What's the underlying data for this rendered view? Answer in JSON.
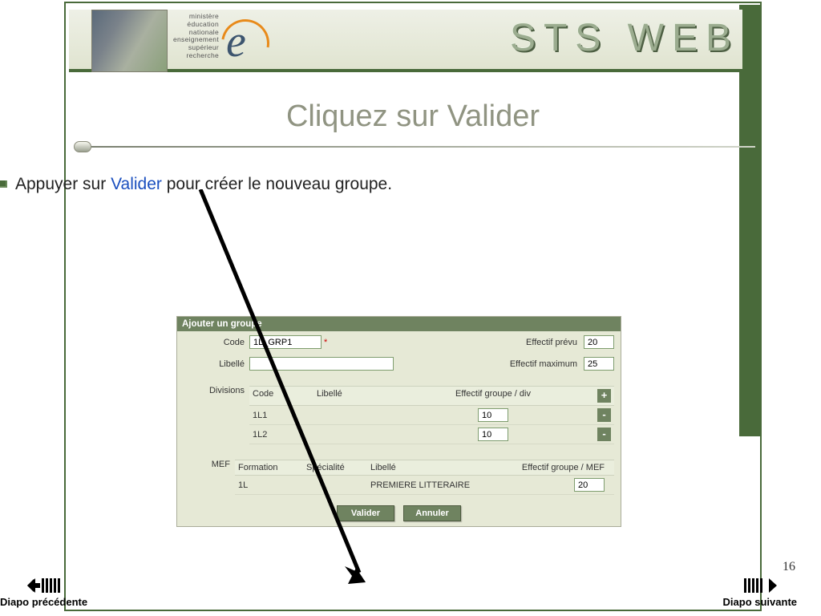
{
  "header": {
    "ministry_lines": "ministère\néducation\nnationale\nenseignement\nsupérieur\nrecherche",
    "title": "STS WEB"
  },
  "slide": {
    "title": "Cliquez sur Valider",
    "bullet_prefix": "Appuyer sur ",
    "bullet_highlight": "Valider",
    "bullet_suffix": " pour créer le nouveau groupe.",
    "page_number": "16"
  },
  "panel": {
    "title": "Ajouter un groupe",
    "code_label": "Code",
    "code_value": "1L_GRP1",
    "effectif_prevu_label": "Effectif prévu",
    "effectif_prevu_value": "20",
    "libelle_label": "Libellé",
    "libelle_value": "",
    "effectif_max_label": "Effectif maximum",
    "effectif_max_value": "25",
    "divisions_label": "Divisions",
    "div_headers": {
      "code": "Code",
      "libelle": "Libellé",
      "eff": "Effectif groupe / div"
    },
    "div_rows": [
      {
        "code": "1L1",
        "eff": "10"
      },
      {
        "code": "1L2",
        "eff": "10"
      }
    ],
    "mef_label": "MEF",
    "mef_headers": {
      "formation": "Formation",
      "specialite": "Spécialité",
      "libelle": "Libellé",
      "eff": "Effectif groupe / MEF"
    },
    "mef_rows": [
      {
        "formation": "1L",
        "specialite": "",
        "libelle": "PREMIERE LITTERAIRE",
        "eff": "20"
      }
    ],
    "valider_label": "Valider",
    "annuler_label": "Annuler",
    "plus": "+",
    "minus": "-"
  },
  "nav": {
    "prev": "Diapo précédente",
    "next": "Diapo suivante"
  }
}
